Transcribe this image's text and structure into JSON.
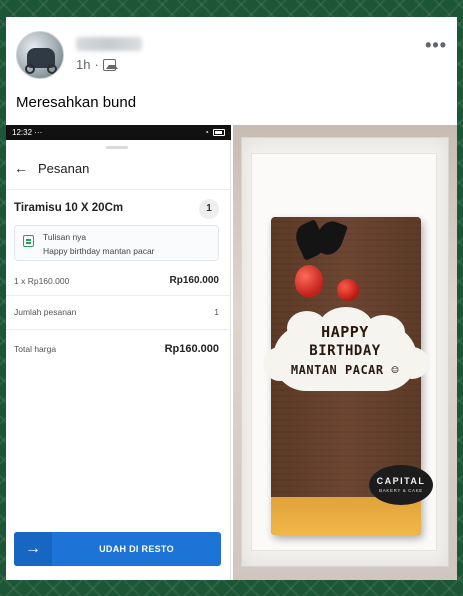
{
  "post": {
    "time": "1h",
    "separator": "·",
    "caption": "Meresahkan bund",
    "more_label": "•••"
  },
  "phone": {
    "status": {
      "time": "12:32",
      "dots": "···"
    },
    "appbar": {
      "back": "←",
      "title": "Pesanan"
    },
    "item": {
      "title": "Tiramisu 10 X 20Cm",
      "qty": "1"
    },
    "note": {
      "title": "Tulisan nya",
      "text": "Happy birthday mantan pacar"
    },
    "price_row": {
      "label": "1 x Rp160.000",
      "value": "Rp160.000"
    },
    "count_row": {
      "label": "Jumlah pesanan",
      "value": "1"
    },
    "total_row": {
      "label": "Total harga",
      "value": "Rp160.000"
    },
    "cta": {
      "arrow": "→",
      "label": "UDAH DI RESTO"
    }
  },
  "photo": {
    "cake_text": [
      "HAPPY",
      "BIRTHDAY",
      "MANTAN PACAR ☺"
    ],
    "logo": {
      "name": "CAPITAL",
      "sub": "BAKERY & CAKE"
    }
  },
  "colors": {
    "background": "#1d5636",
    "cta": "#1e73d6",
    "accent": "#2aa05c"
  }
}
